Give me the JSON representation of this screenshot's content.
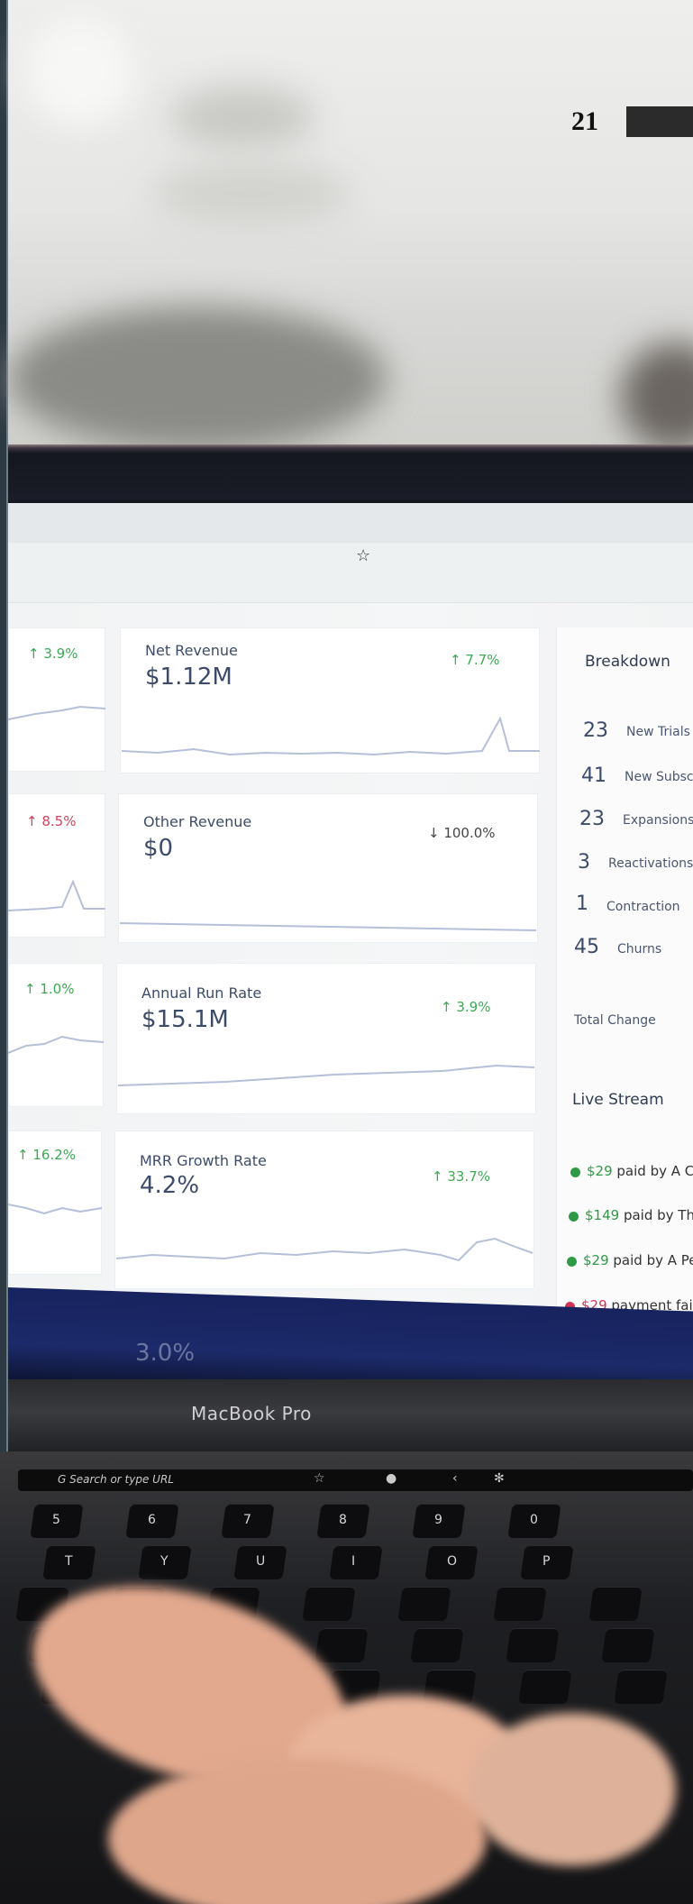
{
  "page": {
    "number": "21"
  },
  "browser": {
    "star_icon": "star-icon"
  },
  "cards": [
    {
      "left_delta": "3.9%",
      "title": "Net Revenue",
      "value": "$1.12M",
      "delta": "7.7%",
      "delta_dir": "up"
    },
    {
      "left_delta": "8.5%",
      "title": "Other Revenue",
      "value": "$0",
      "delta": "100.0%",
      "delta_dir": "down"
    },
    {
      "left_delta": "1.0%",
      "title": "Annual Run Rate",
      "value": "$15.1M",
      "delta": "3.9%",
      "delta_dir": "up"
    },
    {
      "left_delta": "16.2%",
      "title": "MRR Growth Rate",
      "value": "4.2%",
      "delta": "33.7%",
      "delta_dir": "up"
    }
  ],
  "breakdown": {
    "title": "Breakdown",
    "rows": [
      {
        "num": "23",
        "label": "New Trials"
      },
      {
        "num": "41",
        "label": "New Subsc"
      },
      {
        "num": "23",
        "label": "Expansions"
      },
      {
        "num": "3",
        "label": "Reactivations"
      },
      {
        "num": "1",
        "label": "Contraction"
      },
      {
        "num": "45",
        "label": "Churns"
      }
    ],
    "total_label": "Total Change"
  },
  "live_stream": {
    "title": "Live Stream",
    "items": [
      {
        "amount": "$29",
        "text": " paid by A Co",
        "status": "success",
        "color": "#2e9a46"
      },
      {
        "amount": "$149",
        "text": " paid by Tha",
        "status": "success",
        "color": "#2e9a46"
      },
      {
        "amount": "$29",
        "text": " paid by A Per",
        "status": "success",
        "color": "#2e9a46"
      },
      {
        "amount": "$29",
        "text": " payment faile",
        "status": "failed",
        "color": "#cc3355"
      }
    ]
  },
  "under_screen_text": "3.0%",
  "laptop": {
    "brand": "MacBook Pro",
    "touchbar_text": "Search or type URL"
  },
  "keys": {
    "row1": [
      "5",
      "6",
      "7",
      "8",
      "9",
      "0"
    ],
    "row2": [
      "T",
      "Y",
      "U",
      "I",
      "O",
      "P"
    ]
  },
  "colors": {
    "up": "#3aaa52",
    "down_red": "#d4405a",
    "title": "#3d4b6a",
    "screen_blue": "#1c2a6a"
  }
}
